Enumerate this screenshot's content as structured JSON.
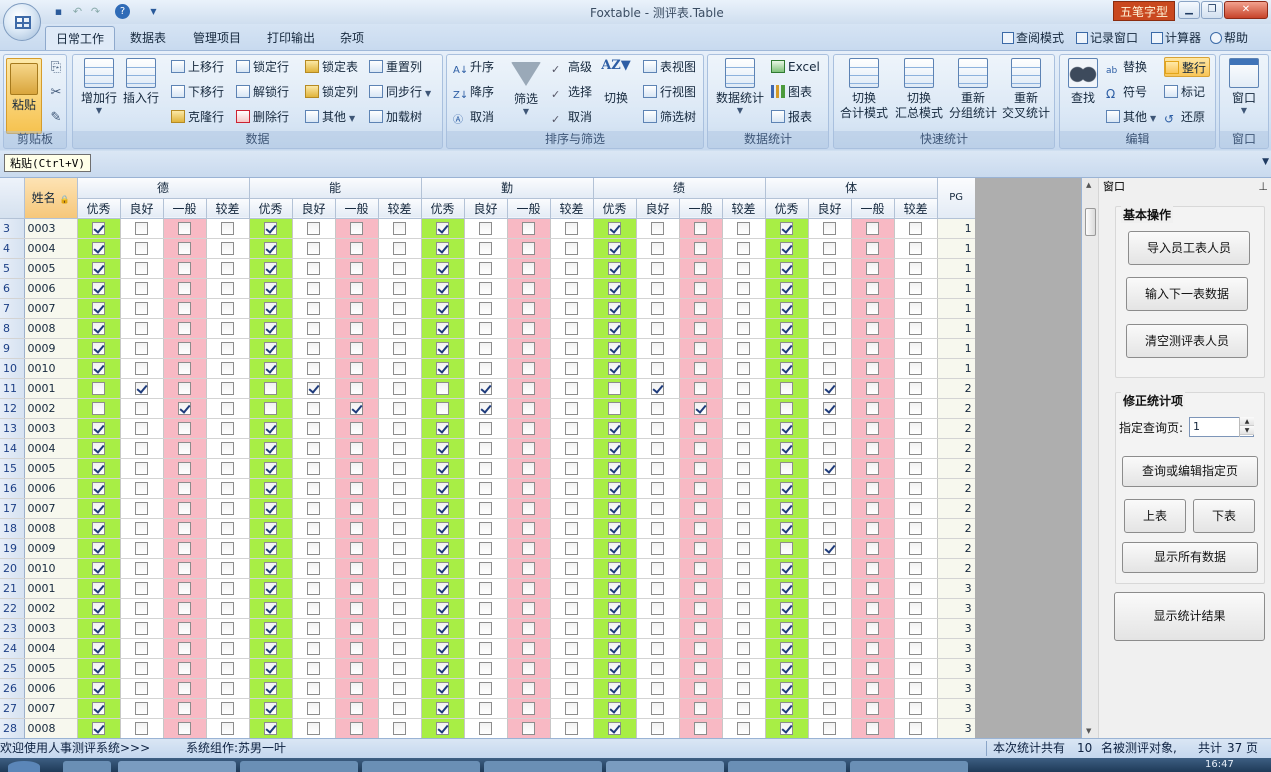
{
  "window": {
    "title": "Foxtable - 测评表.Table",
    "brand_logo_text": "五笔字型"
  },
  "tabs": [
    "日常工作",
    "数据表",
    "管理项目",
    "打印输出",
    "杂项"
  ],
  "right_links": [
    "查阅模式",
    "记录窗口",
    "计算器",
    "帮助"
  ],
  "ribbon": {
    "clipboard": {
      "label": "剪贴板",
      "paste": "粘贴"
    },
    "data": {
      "label": "数据",
      "add_row": "增加行",
      "insert_row": "插入行",
      "move_up": "上移行",
      "move_down": "下移行",
      "clone_row": "克隆行",
      "lock_row": "锁定行",
      "unlock_row": "解锁行",
      "delete_row": "删除行",
      "lock_table": "锁定表",
      "lock_col": "锁定列",
      "other": "其他",
      "reset_col": "重置列",
      "sync_row": "同步行",
      "load_tree": "加载树"
    },
    "sort_filter": {
      "label": "排序与筛选",
      "asc": "升序",
      "desc": "降序",
      "cancel": "取消",
      "filter": "筛选",
      "advanced": "高级",
      "select": "选择",
      "cancel2": "取消",
      "switch": "切换",
      "table_view": "表视图",
      "row_view": "行视图",
      "filter_tree": "筛选树"
    },
    "stats": {
      "label": "数据统计",
      "stats": "数据统计",
      "excel": "Excel",
      "chart": "图表",
      "report": "报表"
    },
    "quick": {
      "label": "快速统计",
      "b1": [
        "切换",
        "合计模式"
      ],
      "b2": [
        "切换",
        "汇总模式"
      ],
      "b3": [
        "重新",
        "分组统计"
      ],
      "b4": [
        "重新",
        "交叉统计"
      ]
    },
    "edit": {
      "label": "编辑",
      "find": "查找",
      "replace": "替换",
      "symbol": "符号",
      "other": "其他",
      "tidy": "整行",
      "mark": "标记",
      "restore": "还原"
    },
    "window": {
      "label": "窗口",
      "window": "窗口"
    }
  },
  "paste_tooltip": "粘贴(Ctrl+V)",
  "grid": {
    "name_header": "姓名",
    "groups": [
      "德",
      "能",
      "勤",
      "绩",
      "体"
    ],
    "levels": [
      "优秀",
      "良好",
      "一般",
      "较差"
    ],
    "pg_header": "PG",
    "rows": [
      {
        "n": "3",
        "name": "0003",
        "c": [
          0,
          0,
          0,
          0,
          0
        ],
        "pg": "1"
      },
      {
        "n": "4",
        "name": "0004",
        "c": [
          0,
          0,
          0,
          0,
          0
        ],
        "pg": "1"
      },
      {
        "n": "5",
        "name": "0005",
        "c": [
          0,
          0,
          0,
          0,
          0
        ],
        "pg": "1"
      },
      {
        "n": "6",
        "name": "0006",
        "c": [
          0,
          0,
          0,
          0,
          0
        ],
        "pg": "1"
      },
      {
        "n": "7",
        "name": "0007",
        "c": [
          0,
          0,
          0,
          0,
          0
        ],
        "pg": "1"
      },
      {
        "n": "8",
        "name": "0008",
        "c": [
          0,
          0,
          0,
          0,
          0
        ],
        "pg": "1"
      },
      {
        "n": "9",
        "name": "0009",
        "c": [
          0,
          0,
          0,
          0,
          0
        ],
        "pg": "1"
      },
      {
        "n": "10",
        "name": "0010",
        "c": [
          0,
          0,
          0,
          0,
          0
        ],
        "pg": "1"
      },
      {
        "n": "11",
        "name": "0001",
        "c": [
          1,
          1,
          1,
          1,
          1
        ],
        "pg": "2"
      },
      {
        "n": "12",
        "name": "0002",
        "c": [
          2,
          2,
          1,
          2,
          1
        ],
        "pg": "2"
      },
      {
        "n": "13",
        "name": "0003",
        "c": [
          0,
          0,
          0,
          0,
          0
        ],
        "pg": "2"
      },
      {
        "n": "14",
        "name": "0004",
        "c": [
          0,
          0,
          0,
          0,
          0
        ],
        "pg": "2"
      },
      {
        "n": "15",
        "name": "0005",
        "c": [
          0,
          0,
          0,
          0,
          1
        ],
        "pg": "2"
      },
      {
        "n": "16",
        "name": "0006",
        "c": [
          0,
          0,
          0,
          0,
          0
        ],
        "pg": "2"
      },
      {
        "n": "17",
        "name": "0007",
        "c": [
          0,
          0,
          0,
          0,
          0
        ],
        "pg": "2"
      },
      {
        "n": "18",
        "name": "0008",
        "c": [
          0,
          0,
          0,
          0,
          0
        ],
        "pg": "2"
      },
      {
        "n": "19",
        "name": "0009",
        "c": [
          0,
          0,
          0,
          0,
          1
        ],
        "pg": "2"
      },
      {
        "n": "20",
        "name": "0010",
        "c": [
          0,
          0,
          0,
          0,
          0
        ],
        "pg": "2"
      },
      {
        "n": "21",
        "name": "0001",
        "c": [
          0,
          0,
          0,
          0,
          0
        ],
        "pg": "3"
      },
      {
        "n": "22",
        "name": "0002",
        "c": [
          0,
          0,
          0,
          0,
          0
        ],
        "pg": "3"
      },
      {
        "n": "23",
        "name": "0003",
        "c": [
          0,
          0,
          0,
          0,
          0
        ],
        "pg": "3"
      },
      {
        "n": "24",
        "name": "0004",
        "c": [
          0,
          0,
          0,
          0,
          0
        ],
        "pg": "3"
      },
      {
        "n": "25",
        "name": "0005",
        "c": [
          0,
          0,
          0,
          0,
          0
        ],
        "pg": "3"
      },
      {
        "n": "26",
        "name": "0006",
        "c": [
          0,
          0,
          0,
          0,
          0
        ],
        "pg": "3"
      },
      {
        "n": "27",
        "name": "0007",
        "c": [
          0,
          0,
          0,
          0,
          0
        ],
        "pg": "3"
      },
      {
        "n": "28",
        "name": "0008",
        "c": [
          0,
          0,
          0,
          0,
          0
        ],
        "pg": "3"
      }
    ],
    "colors": {
      "excellent": "#a8ee45",
      "poor": "#f8b9c4",
      "name_bg": "#f7f8ee"
    }
  },
  "dock": {
    "title": "窗口",
    "basic": {
      "title": "基本操作",
      "import_btn": "导入员工表人员",
      "next_btn": "输入下一表数据",
      "clear_btn": "清空测评表人员"
    },
    "fix": {
      "title": "修正统计项",
      "page_label": "指定查询页:",
      "page_value": "1",
      "query_btn": "查询或编辑指定页",
      "prev_btn": "上表",
      "next_btn": "下表",
      "showall_btn": "显示所有数据"
    },
    "result_btn": "显示统计结果"
  },
  "status": {
    "welcome": "欢迎使用人事测评系统>>>",
    "author": "系统组作:苏男一叶",
    "summary_prefix": "本次统计共有",
    "count": "10",
    "summary_suffix": "名被测评对象,",
    "pages_prefix": "共计",
    "pages": "37",
    "pages_suffix": "页"
  },
  "taskbar": {
    "clock": "16:47"
  }
}
